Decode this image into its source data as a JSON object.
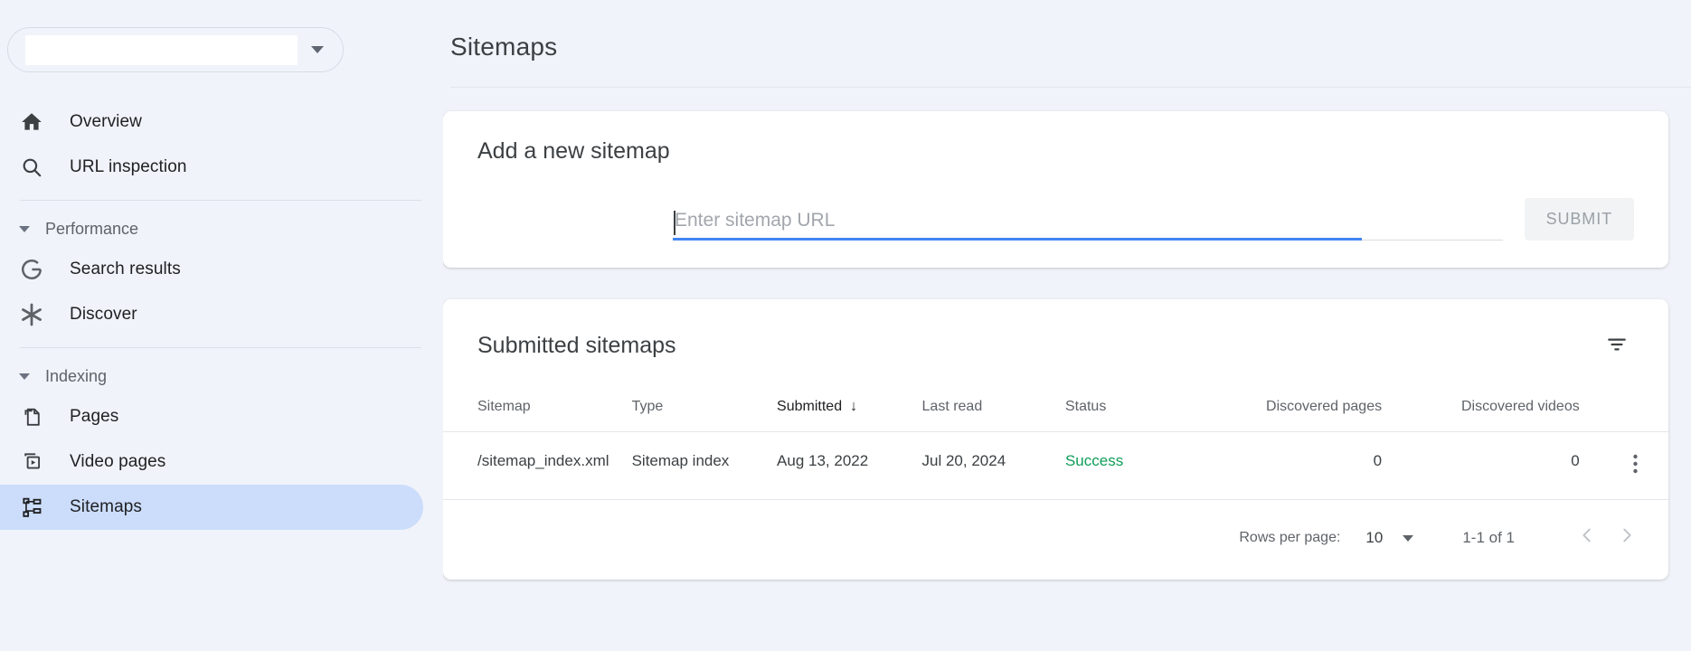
{
  "sidebar": {
    "property_selector": {
      "value": "",
      "caret_icon": "chevron-down-icon"
    },
    "top_items": [
      {
        "label": "Overview",
        "icon": "home-icon"
      },
      {
        "label": "URL inspection",
        "icon": "search-icon"
      }
    ],
    "sections": [
      {
        "label": "Performance",
        "caret_icon": "caret-down-icon",
        "items": [
          {
            "label": "Search results",
            "icon": "google-g-icon"
          },
          {
            "label": "Discover",
            "icon": "discover-asterisk-icon"
          }
        ]
      },
      {
        "label": "Indexing",
        "caret_icon": "caret-down-icon",
        "items": [
          {
            "label": "Pages",
            "icon": "pages-icon",
            "selected": false
          },
          {
            "label": "Video pages",
            "icon": "video-pages-icon",
            "selected": false
          },
          {
            "label": "Sitemaps",
            "icon": "sitemaps-icon",
            "selected": true
          }
        ]
      }
    ]
  },
  "main": {
    "page_title": "Sitemaps",
    "add_card": {
      "title": "Add a new sitemap",
      "input_value": "",
      "input_placeholder": "Enter sitemap URL",
      "submit_label": "SUBMIT"
    },
    "table_card": {
      "title": "Submitted sitemaps",
      "filter_icon": "filter-icon",
      "columns": [
        {
          "key": "sitemap",
          "label": "Sitemap",
          "sorted": false,
          "align": "left"
        },
        {
          "key": "type",
          "label": "Type",
          "sorted": false,
          "align": "left"
        },
        {
          "key": "submitted",
          "label": "Submitted",
          "sorted": true,
          "sort_arrow": "↓",
          "align": "left"
        },
        {
          "key": "last_read",
          "label": "Last read",
          "sorted": false,
          "align": "left"
        },
        {
          "key": "status",
          "label": "Status",
          "sorted": false,
          "align": "left"
        },
        {
          "key": "discovered_pages",
          "label": "Discovered pages",
          "sorted": false,
          "align": "right"
        },
        {
          "key": "discovered_videos",
          "label": "Discovered videos",
          "sorted": false,
          "align": "right"
        }
      ],
      "rows": [
        {
          "sitemap": "/sitemap_index.xml",
          "type": "Sitemap index",
          "submitted": "Aug 13, 2022",
          "last_read": "Jul 20, 2024",
          "status": "Success",
          "discovered_pages": "0",
          "discovered_videos": "0",
          "menu_icon": "more-vert-icon"
        }
      ],
      "footer": {
        "rows_per_page_label": "Rows per page:",
        "rows_per_page_value": "10",
        "range_label": "1-1 of 1",
        "prev_icon": "chevron-left-icon",
        "next_icon": "chevron-right-icon"
      }
    }
  },
  "colors": {
    "page_background": "#f0f3f9",
    "card_background": "#ffffff",
    "selected_nav": "#ccddfb",
    "focus_underline": "#4285f4",
    "status_success": "#0f9d58",
    "text_primary": "#202124",
    "text_secondary": "#5f6368"
  }
}
